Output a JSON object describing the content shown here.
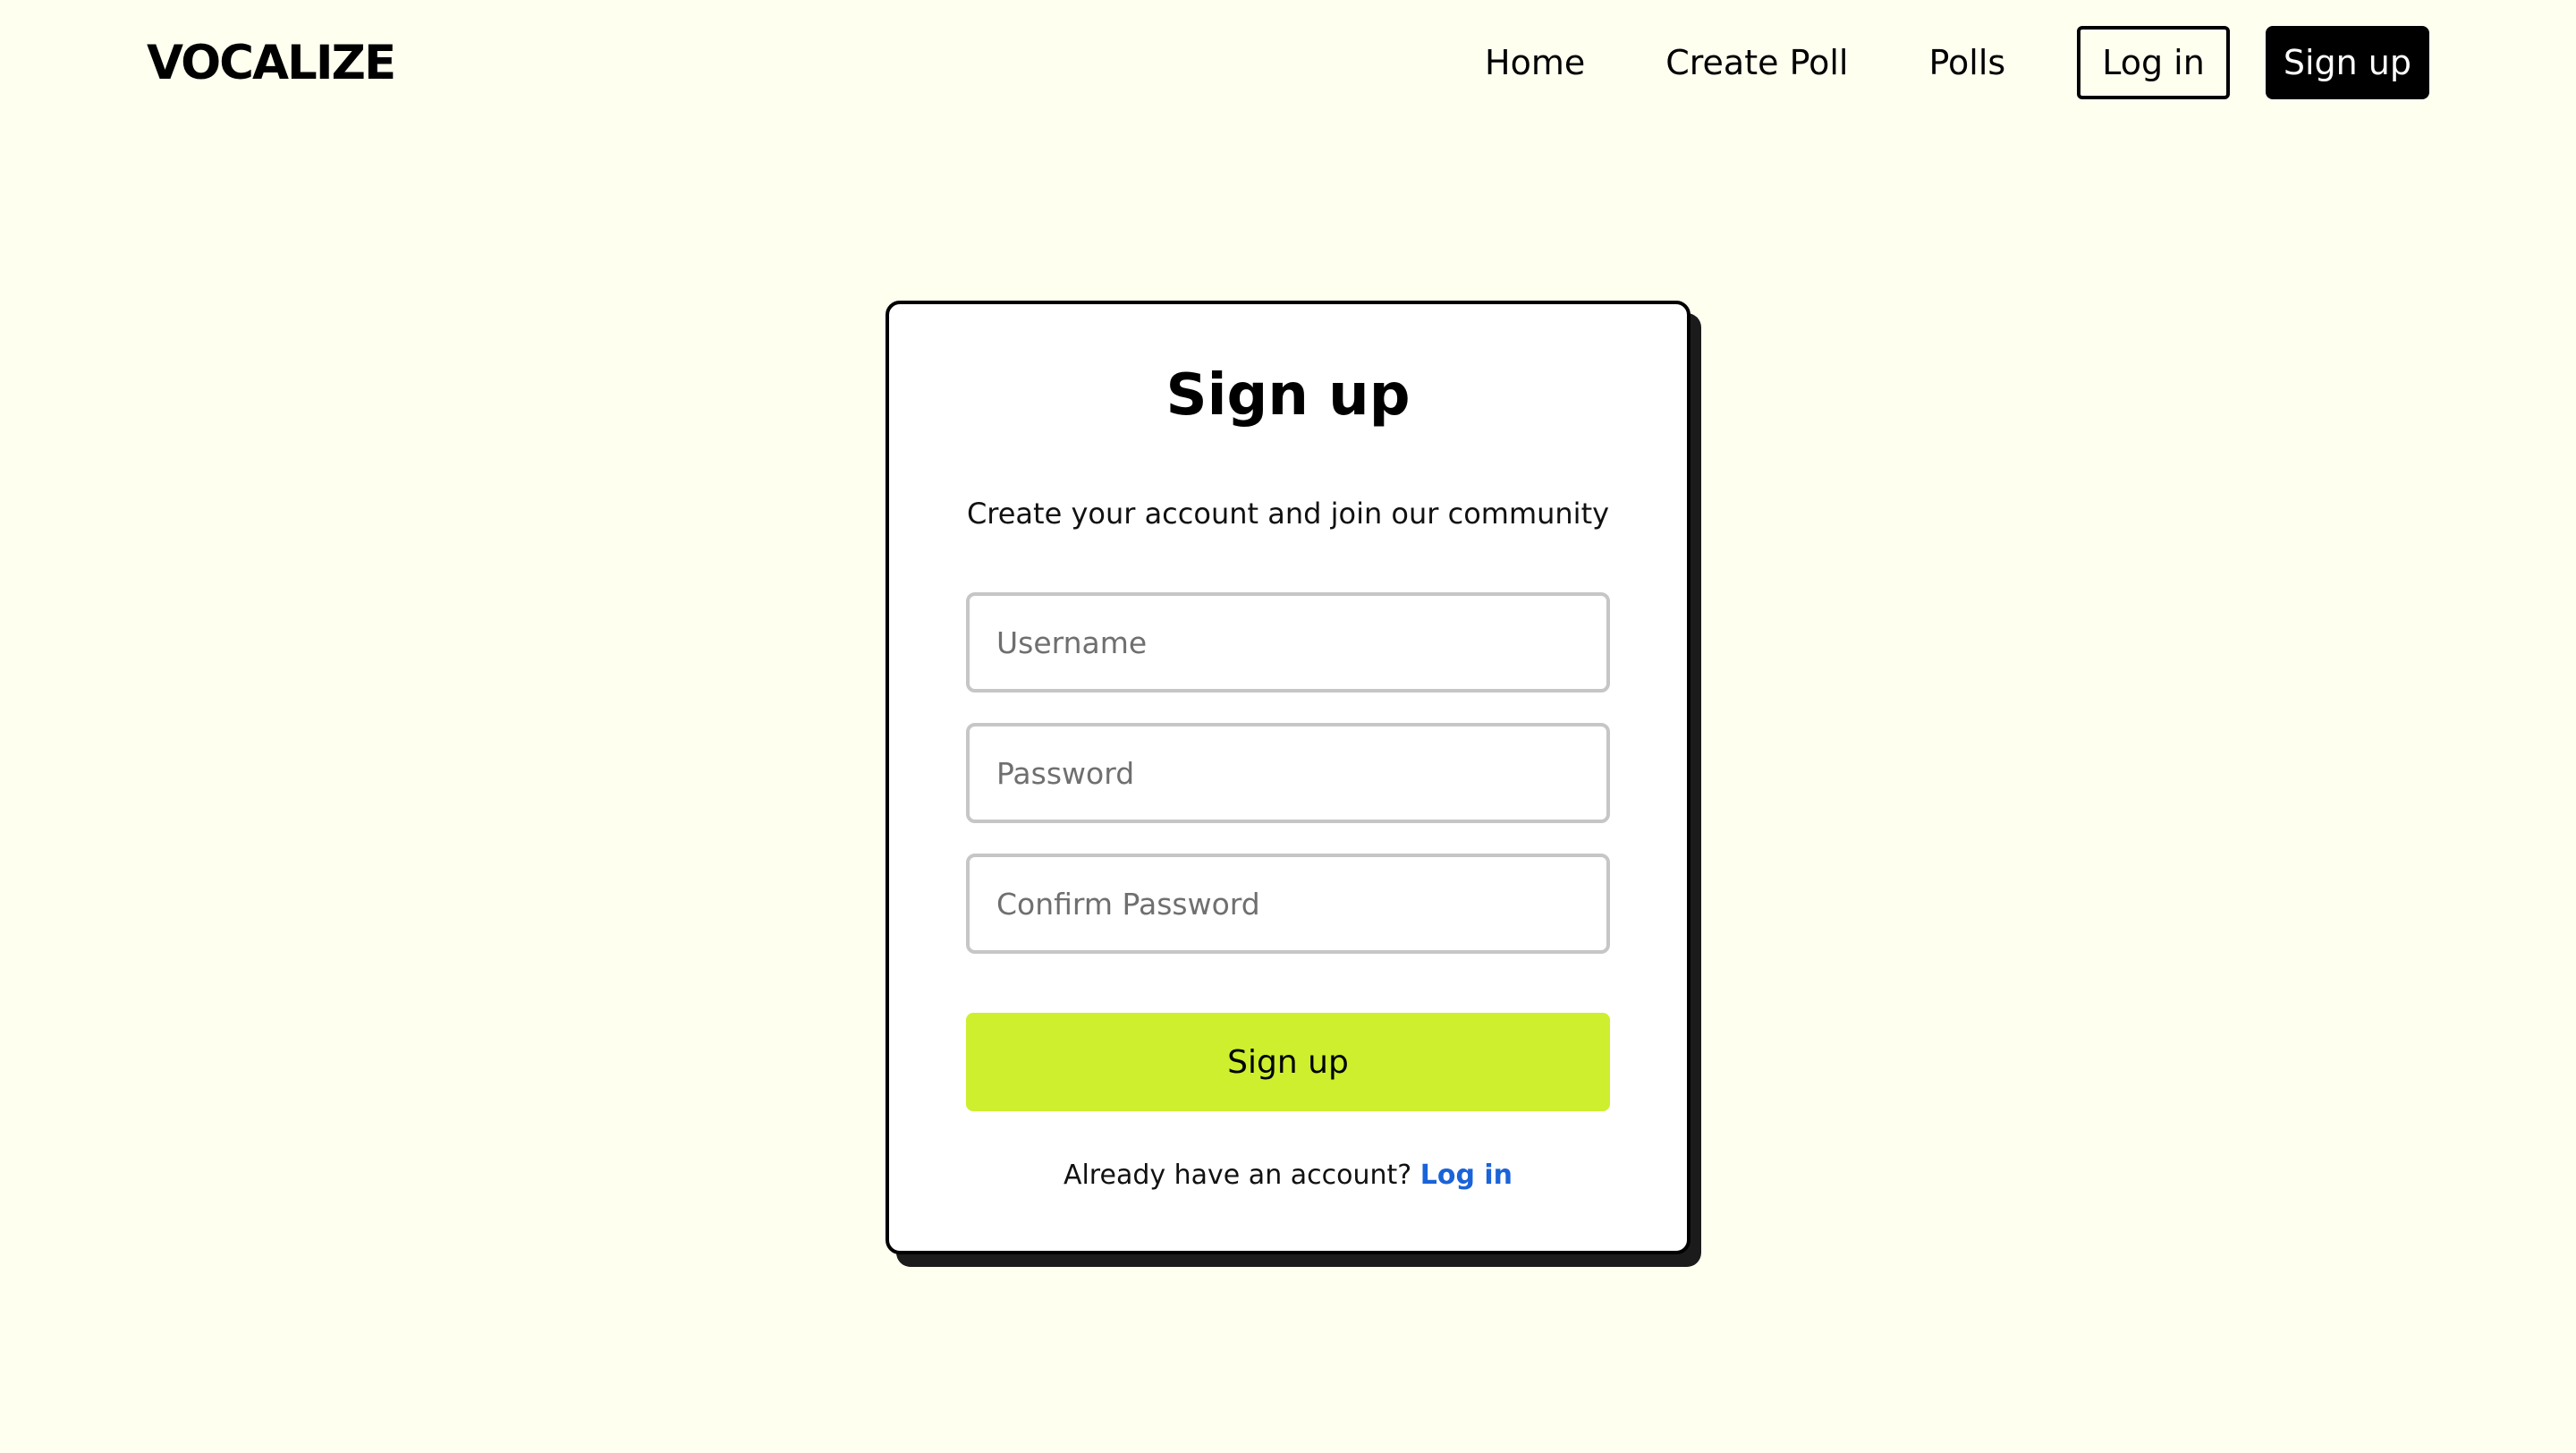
{
  "brand": {
    "name": "VOCALIZE",
    "accent_color": "#CDEF2E",
    "background_color": "#FFFFF0",
    "link_color": "#1A63D8"
  },
  "nav": {
    "links": [
      "Home",
      "Create Poll",
      "Polls"
    ],
    "login_label": "Log in",
    "signup_label": "Sign up"
  },
  "signup_form": {
    "title": "Sign up",
    "subtitle": "Create your account and join our community",
    "username_placeholder": "Username",
    "password_placeholder": "Password",
    "confirm_password_placeholder": "Confirm Password",
    "submit_label": "Sign up",
    "footer_text": "Already have an account?",
    "footer_link_label": "Log in"
  }
}
